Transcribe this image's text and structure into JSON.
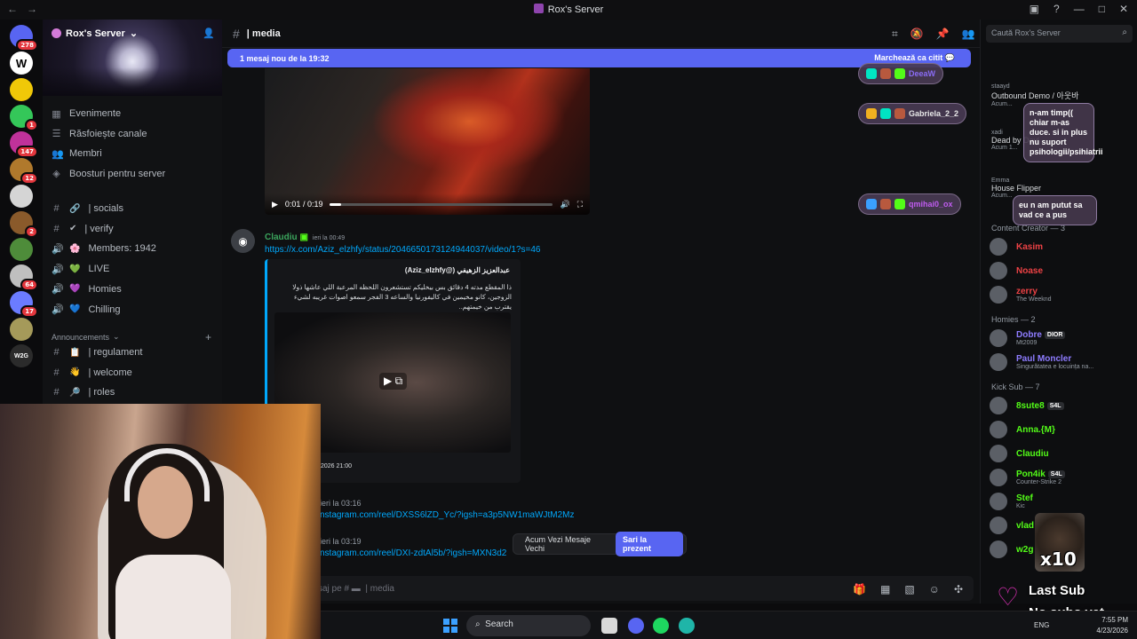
{
  "window": {
    "title": "Rox's Server"
  },
  "server": {
    "name": "Rox's Server"
  },
  "rail": {
    "servers": [
      {
        "color": "#5865f2",
        "badge": "278"
      },
      {
        "color": "#ffffff",
        "label": "W",
        "badge": ""
      },
      {
        "color": "#f0c808",
        "badge": ""
      },
      {
        "color": "#34c759",
        "badge": "1"
      },
      {
        "color": "#c0329a",
        "badge": "147"
      },
      {
        "color": "#b0792c",
        "badge": "12"
      },
      {
        "color": "#d5d5d5",
        "badge": ""
      },
      {
        "color": "#8a5a2b",
        "badge": "2"
      },
      {
        "color": "#4e8c3a",
        "badge": ""
      },
      {
        "color": "#bfbfbf",
        "badge": "64"
      },
      {
        "color": "#6b7cff",
        "badge": "17"
      },
      {
        "color": "#a59a5a",
        "badge": ""
      },
      {
        "color": "#2b2b2b",
        "label": "W2G",
        "badge": ""
      }
    ]
  },
  "sidebar": {
    "top_items": [
      {
        "label": "Evenimente",
        "icon": "calendar-icon"
      },
      {
        "label": "Răsfoiește canale",
        "icon": "browse-channels-icon"
      },
      {
        "label": "Membri",
        "icon": "members-icon"
      },
      {
        "label": "Boosturi pentru server",
        "icon": "boost-icon"
      }
    ],
    "channels": [
      {
        "type": "#",
        "emoji": "🔗",
        "label": "| socials"
      },
      {
        "type": "#",
        "emoji": "✔",
        "label": "| verify"
      },
      {
        "type": "🔊",
        "emoji": "🌸",
        "label": "Members: 1942"
      },
      {
        "type": "🔊",
        "emoji": "💚",
        "label": "LIVE"
      },
      {
        "type": "🔊",
        "emoji": "💜",
        "label": "Homies"
      },
      {
        "type": "🔊",
        "emoji": "💙",
        "label": "Chilling"
      }
    ],
    "category": "Announcements",
    "announcement_channels": [
      {
        "emoji": "📋",
        "label": "| regulament"
      },
      {
        "emoji": "👋",
        "label": "| welcome"
      },
      {
        "emoji": "🔎",
        "label": "| roles"
      }
    ]
  },
  "channel": {
    "name": "| media"
  },
  "newbar": {
    "text": "1 mesaj nou de la 19:32",
    "mark": "Marchează ca citit"
  },
  "video": {
    "time": "0:01 / 0:19",
    "progress": 0.05
  },
  "message": {
    "author": "Claudiu",
    "timestamp": "ieri la 00:49",
    "link": "https://x.com/Aziz_elzhfy/status/2046650173124944037/video/1?s=46"
  },
  "embed": {
    "author": "عبدالعزيز الزهيفي (@Aziz_elzhfy)",
    "text": "ذا المقطع مدته 4 دقائق بس بيخليكم تستشعرون اللحظه المرعبة اللي عاشها ذولا الزوجين، كانو مخيمين في كاليفورنيا والساعه 3 الفجر سمعو اصوات غريبه لشيء يقترب من خيمتهم..",
    "date": "2026 21:00"
  },
  "later_messages": [
    {
      "timestamp": "ieri la 03:16",
      "link": "nstagram.com/reel/DXSS6lZD_Yc/?igsh=a3p5NW1maWJtM2Mz"
    },
    {
      "timestamp": "ieri la 03:19",
      "link": "nstagram.com/reel/DXI-zdtAl5b/?igsh=MXN3d2"
    }
  ],
  "jump": {
    "label": "Acum Vezi Mesaje Vechi",
    "button": "Sari la prezent"
  },
  "composer": {
    "placeholder": "saj pe #",
    "channel": "| media"
  },
  "overlay_pills": [
    {
      "name": "DeeaW",
      "color": "#8a6cf5"
    },
    {
      "name": "Gabriela_2_2",
      "color": "#e8e8e8"
    },
    {
      "name": "qmihai0_ox",
      "color": "#c05cf0"
    }
  ],
  "overlay_chat": [
    {
      "text": "n-am timp(( chiar m-as duce. si in plus nu suport psihologii/psihiatrii"
    },
    {
      "text": "eu n am putut sa vad ce a pus"
    }
  ],
  "members": {
    "search_placeholder": "Caută Rox's Server",
    "activities": [
      {
        "name": "staayd",
        "title": "Outbound Demo / 아웃바",
        "sub": "Acum..."
      },
      {
        "name": "xadi",
        "title": "Dead by Dayl",
        "sub": "Acum 1..."
      },
      {
        "name": "Emma",
        "title": "House Flipper",
        "sub": "Acum..."
      }
    ],
    "categories": [
      {
        "title": "Content Creator — 3",
        "members": [
          {
            "name": "Kasim",
            "color": "#ed4245",
            "sub": ""
          },
          {
            "name": "Noase",
            "color": "#ed4245",
            "sub": ""
          },
          {
            "name": "zerry",
            "color": "#ed4245",
            "sub": "The Weeknd"
          }
        ]
      },
      {
        "title": "Homies — 2",
        "members": [
          {
            "name": "Dobre",
            "color": "#8e7cff",
            "tag": "DIOR",
            "sub": "Mt2009"
          },
          {
            "name": "Paul Moncler",
            "color": "#8e7cff",
            "sub": "Singurătatea e locuința na..."
          }
        ]
      },
      {
        "title": "Kick Sub — 7",
        "members": [
          {
            "name": "8sute8",
            "color": "#53fc18",
            "tag": "S4L",
            "sub": ""
          },
          {
            "name": "Anna.{M}",
            "color": "#53fc18",
            "sub": ""
          },
          {
            "name": "Claudiu",
            "color": "#53fc18",
            "sub": ""
          },
          {
            "name": "Pon4ik",
            "color": "#53fc18",
            "tag": "S4L",
            "sub": "Counter-Strike 2"
          },
          {
            "name": "Stef",
            "color": "#53fc18",
            "sub": "Kic"
          },
          {
            "name": "vlad",
            "color": "#53fc18",
            "sub": ""
          },
          {
            "name": "w2g",
            "color": "#53fc18",
            "sub": ""
          }
        ]
      }
    ]
  },
  "taskbar": {
    "search": "Search",
    "lang": "ENG",
    "time": "7:55 PM",
    "date": "4/23/2026"
  },
  "alert": {
    "multiplier": "x10",
    "line1": "Last Sub",
    "line2": "No subs yet"
  },
  "colors": {
    "accent": "#5865f2",
    "link": "#00a8fc",
    "kick": "#53fc18",
    "danger": "#ed4245"
  }
}
